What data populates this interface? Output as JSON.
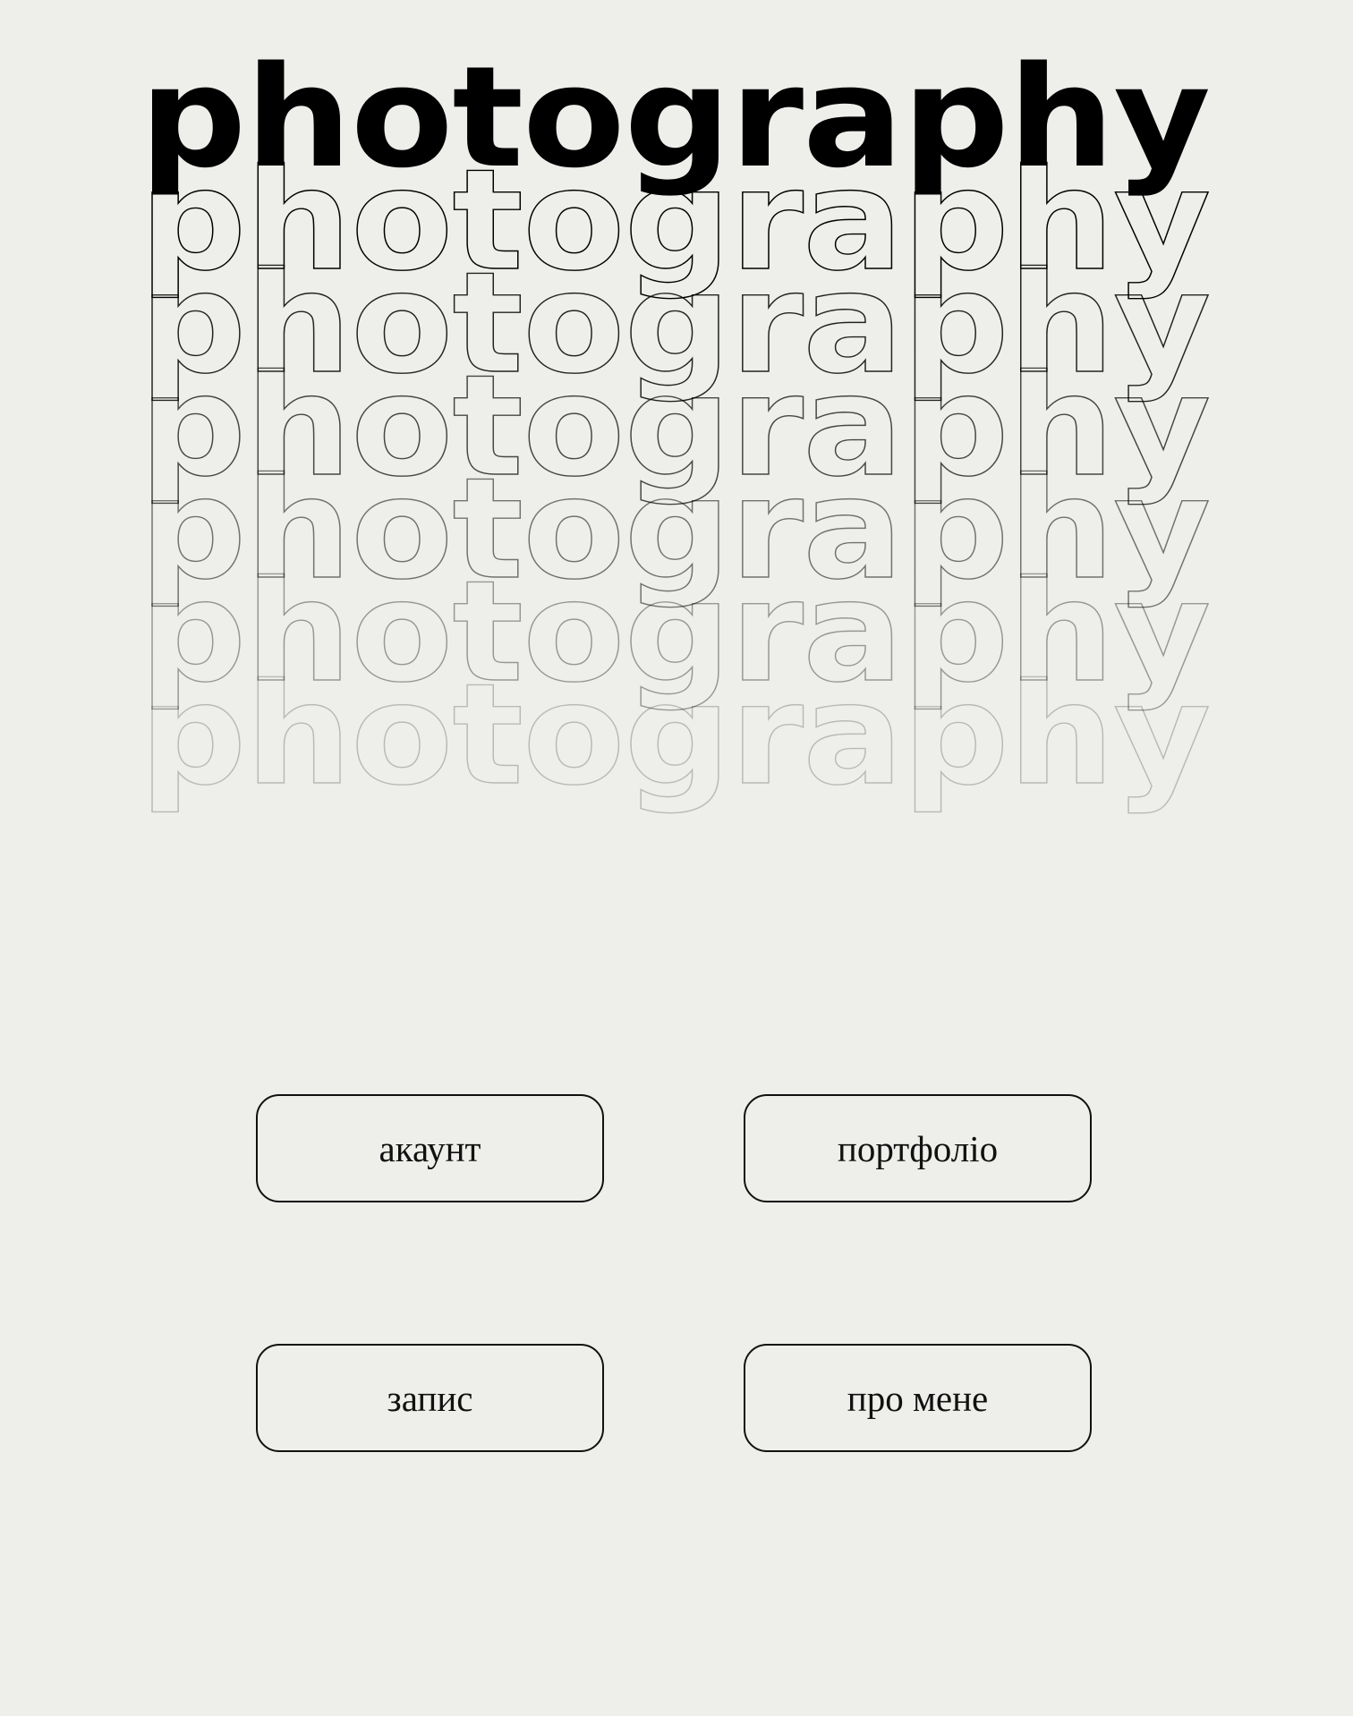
{
  "logo": {
    "word": "photography",
    "rows": [
      {
        "style": "solid"
      },
      {
        "style": "outline",
        "opacity": 1.0
      },
      {
        "style": "outline",
        "opacity": 0.85
      },
      {
        "style": "outline",
        "opacity": 0.7
      },
      {
        "style": "outline",
        "opacity": 0.52
      },
      {
        "style": "outline",
        "opacity": 0.36
      },
      {
        "style": "outline",
        "opacity": 0.22
      }
    ]
  },
  "nav": {
    "account_label": "акаунт",
    "portfolio_label": "портфоліо",
    "booking_label": "запис",
    "about_label": "про мене"
  },
  "colors": {
    "background": "#eeeeea",
    "text": "#111111"
  }
}
